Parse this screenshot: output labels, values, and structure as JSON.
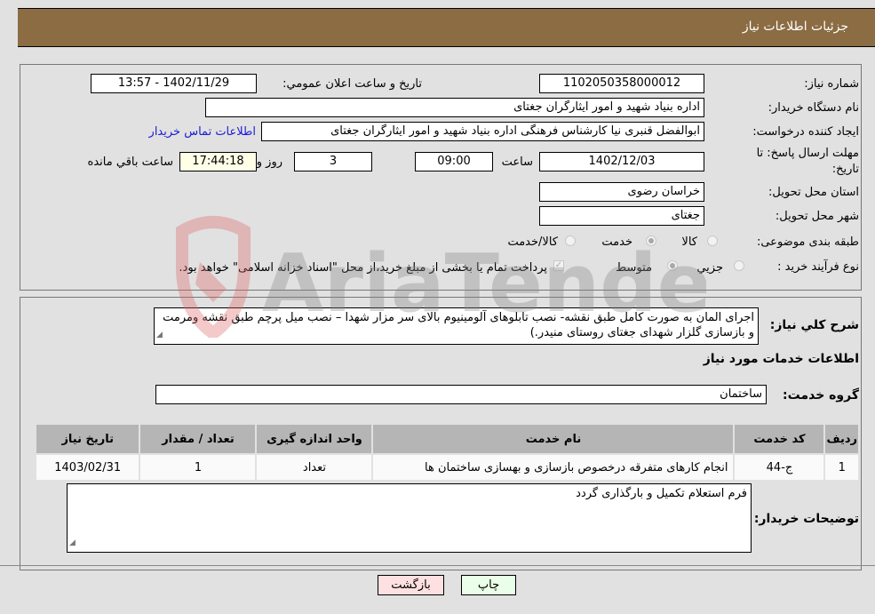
{
  "header": {
    "title": "جزئیات اطلاعات نیاز"
  },
  "need_info": {
    "need_number_label": "شماره نیاز:",
    "need_number": "1102050358000012",
    "announce_label": "تاریخ و ساعت اعلان عمومي:",
    "announce_value": "1402/11/29 - 13:57",
    "buyer_org_label": "نام دستگاه خریدار:",
    "buyer_org": "اداره بنیاد شهید و امور ایثارگران جغتای",
    "creator_label": "ایجاد کننده درخواست:",
    "creator": "ابوالفضل قنبری نیا کارشناس فرهنگی اداره بنیاد شهید و امور ایثارگران جغتای",
    "contact_link": "اطلاعات تماس خریدار",
    "deadline_label_line1": "مهلت ارسال پاسخ: تا",
    "deadline_label_line2": "تاریخ:",
    "deadline_date": "1402/12/03",
    "time_label": "ساعت",
    "deadline_time": "09:00",
    "days_value": "3",
    "days_label": "روز و",
    "remaining_time": "17:44:18",
    "remaining_label": "ساعت باقي مانده",
    "province_label": "استان محل تحویل:",
    "province": "خراسان رضوی",
    "city_label": "شهر محل تحویل:",
    "city": "جغتای",
    "category_label": "طبقه بندی موضوعی:",
    "category_options": [
      {
        "label": "کالا",
        "checked": false
      },
      {
        "label": "خدمت",
        "checked": true
      },
      {
        "label": "کالا/خدمت",
        "checked": false
      }
    ],
    "purchase_type_label": "نوع فرآیند خرید :",
    "purchase_type_options": [
      {
        "label": "جزيي",
        "checked": false
      },
      {
        "label": "متوسط",
        "checked": true
      }
    ],
    "treasury_note": "پرداخت تمام یا بخشی از مبلغ خرید،از محل \"اسناد خزانه اسلامی\" خواهد بود."
  },
  "details": {
    "description_label": "شرح کلي نیاز:",
    "description": "اجرای المان به صورت کامل طبق نقشه- نصب تابلوهای آلومینیوم بالای سر مزار شهدا – نصب میل پرچم طبق نقشه ومرمت و بازسازی گلزار شهدای جغتای روستای منیدر.)",
    "services_title": "اطلاعات خدمات مورد نیاز",
    "service_group_label": "گروه خدمت:",
    "service_group": "ساختمان",
    "table": {
      "headers": [
        "ردیف",
        "کد خدمت",
        "نام خدمت",
        "واحد اندازه گیری",
        "تعداد / مقدار",
        "تاریخ نیاز"
      ],
      "rows": [
        [
          "1",
          "ج-44",
          "انجام کارهای متفرقه درخصوص بازسازی و بهسازی ساختمان ها",
          "تعداد",
          "1",
          "1403/02/31"
        ]
      ]
    },
    "buyer_notes_label": "توضیحات خریدار:",
    "buyer_notes": "فرم استعلام تکمیل و بارگذاری گردد"
  },
  "buttons": {
    "print": "چاپ",
    "back": "بازگشت"
  },
  "watermark": {
    "text": "AriaTender.neT"
  }
}
